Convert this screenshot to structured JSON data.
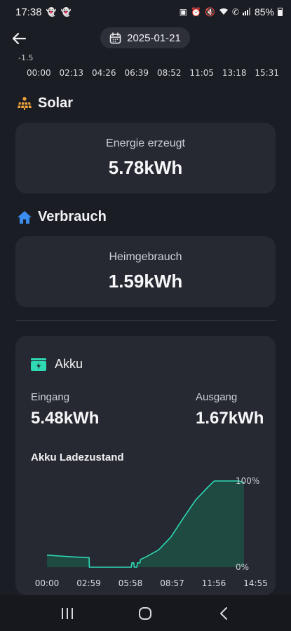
{
  "status_bar": {
    "time": "17:38",
    "battery_percent": "85%",
    "left_icons": [
      "snapchat-icon",
      "snapchat-icon"
    ],
    "right_icons": [
      "gallery-icon",
      "alarm-icon",
      "mute-icon",
      "wifi-icon",
      "call-icon",
      "signal-icon",
      "battery-icon"
    ]
  },
  "header": {
    "back_icon": "back-arrow-icon",
    "date": "2025-01-21",
    "date_icon": "calendar-icon"
  },
  "top_chart": {
    "y_tick": "-1.5",
    "x_ticks": [
      "00:00",
      "02:13",
      "04:26",
      "06:39",
      "08:52",
      "11:05",
      "13:18",
      "15:31"
    ]
  },
  "solar": {
    "title": "Solar",
    "icon": "solar-panel-icon",
    "label": "Energie erzeugt",
    "value": "5.78kWh"
  },
  "consumption": {
    "title": "Verbrauch",
    "icon": "home-icon",
    "label": "Heimgebrauch",
    "value": "1.59kWh"
  },
  "battery": {
    "title": "Akku",
    "icon": "battery-charging-icon",
    "input_label": "Eingang",
    "input_value": "5.48kWh",
    "output_label": "Ausgang",
    "output_value": "1.67kWh",
    "chart_title": "Akku Ladezustand"
  },
  "colors": {
    "accent": "#2ed9b4",
    "background": "#1b1d24",
    "card": "#272932",
    "home_icon": "#3b8df0",
    "solar_icon": "#f0a23b"
  },
  "nav_bar": {
    "icons": [
      "recent-apps-icon",
      "home-button-icon",
      "back-nav-icon"
    ]
  },
  "chart_data": {
    "type": "area",
    "title": "Akku Ladezustand",
    "x_ticks": [
      "00:00",
      "02:59",
      "05:58",
      "08:57",
      "11:56",
      "14:55"
    ],
    "y_ticks": [
      "100%",
      "0%"
    ],
    "ylim": [
      0,
      100
    ],
    "x_unit": "hours",
    "x": [
      0,
      1.0,
      2.0,
      3.4,
      3.42,
      6.8,
      6.85,
      7.0,
      7.05,
      7.25,
      7.3,
      7.5,
      7.55,
      8.0,
      9.0,
      10.0,
      11.0,
      12.0,
      13.0,
      13.5,
      14.0,
      14.5,
      15.5,
      15.9
    ],
    "values": [
      14,
      13,
      12,
      11,
      0,
      0,
      5,
      5,
      0,
      0,
      5,
      5,
      9,
      12,
      20,
      35,
      57,
      78,
      93,
      100,
      100,
      100,
      100,
      98
    ],
    "grid": false,
    "legend": "none"
  }
}
